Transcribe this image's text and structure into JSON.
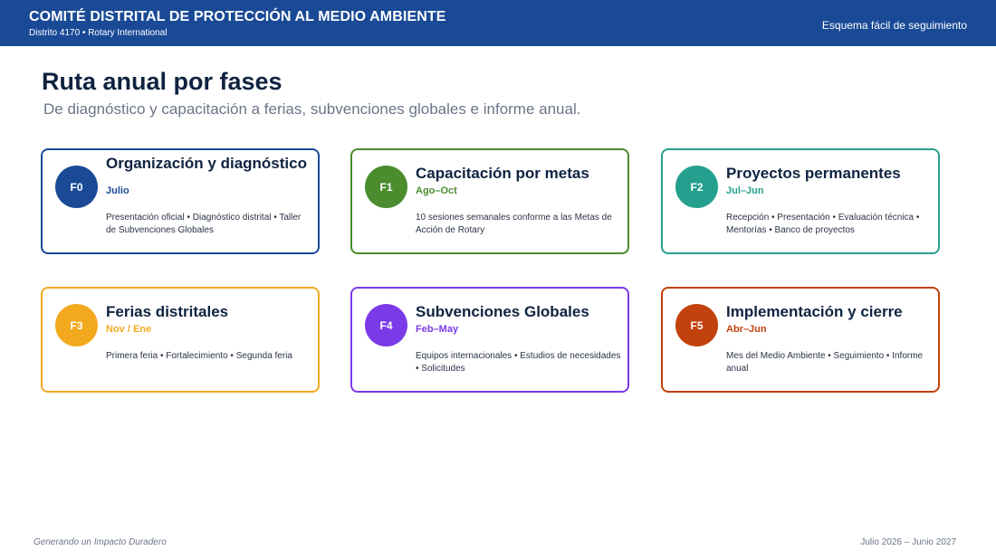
{
  "header": {
    "title": "COMITÉ DISTRITAL DE PROTECCIÓN AL MEDIO AMBIENTE",
    "subtitle": "Distrito 4170 • Rotary International",
    "right_label": "Esquema fácil de seguimiento",
    "color": "#1a4a96"
  },
  "page": {
    "title": "Ruta anual por fases",
    "subtitle": "De diagnóstico y capacitación a ferias, subvenciones globales e informe anual."
  },
  "phases": [
    {
      "code": "F0",
      "title": "Organización y diagnóstico",
      "period": "Julio",
      "description": "Presentación oficial • Diagnóstico distrital • Taller de Subvenciones Globales",
      "color": "#1a4a96"
    },
    {
      "code": "F1",
      "title": "Capacitación por metas",
      "period": "Ago–Oct",
      "description": "10 sesiones semanales conforme a las Metas de Acción de Rotary",
      "color": "#4a8c2e"
    },
    {
      "code": "F2",
      "title": "Proyectos permanentes",
      "period": "Jul–Jun",
      "description": "Recepción • Presentación • Evaluación técnica • Mentorías • Banco de proyectos",
      "color": "#26a08e"
    },
    {
      "code": "F3",
      "title": "Ferias distritales",
      "period": "Nov / Ene",
      "description": "Primera feria • Fortalecimiento • Segunda feria",
      "color": "#f2a91e"
    },
    {
      "code": "F4",
      "title": "Subvenciones Globales",
      "period": "Feb–May",
      "description": "Equipos internacionales • Estudios de necesidades • Solicitudes",
      "color": "#7b3ae8"
    },
    {
      "code": "F5",
      "title": "Implementación y cierre",
      "period": "Abr–Jun",
      "description": "Mes del Medio Ambiente • Seguimiento • Informe anual",
      "color": "#c2410c"
    }
  ],
  "footer": {
    "left": "Generando un Impacto Duradero",
    "right": "Julio 2026 – Junio 2027"
  }
}
